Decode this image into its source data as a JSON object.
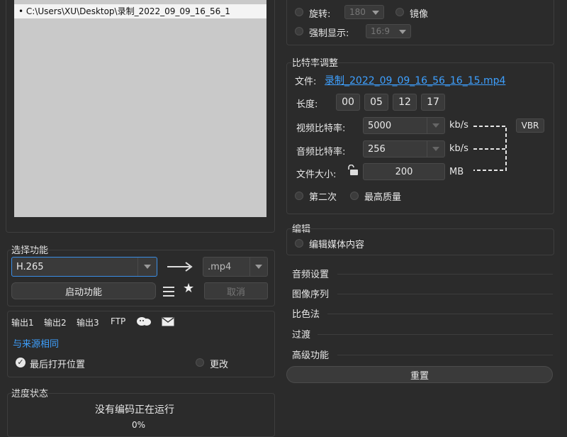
{
  "file_list": {
    "items": [
      "C:\\Users\\XU\\Desktop\\录制_2022_09_09_16_56_1"
    ]
  },
  "transform": {
    "rotate_label": "旋转:",
    "rotate_value": "180",
    "mirror_label": "镜像",
    "force_display_label": "强制显示:",
    "force_display_value": "16:9"
  },
  "bitrate": {
    "section_title": "比特率调整",
    "file_label": "文件:",
    "file_value": "录制_2022_09_09_16_56_16_15.mp4",
    "duration_label": "长度:",
    "duration": [
      "00",
      "05",
      "12",
      "17"
    ],
    "video_label": "视频比特率:",
    "video_value": "5000",
    "video_unit": "kb/s",
    "audio_label": "音频比特率:",
    "audio_value": "256",
    "audio_unit": "kb/s",
    "size_label": "文件大小:",
    "size_value": "200",
    "size_unit": "MB",
    "vbr_label": "VBR",
    "second_pass_label": "第二次",
    "best_quality_label": "最高质量"
  },
  "edit": {
    "title": "编辑",
    "media_label": "编辑媒体内容"
  },
  "collapsibles": [
    "音频设置",
    "图像序列",
    "比色法",
    "过渡",
    "高级功能"
  ],
  "reset_label": "重置",
  "function": {
    "title": "选择功能",
    "codec": "H.265",
    "container": ".mp4",
    "start_label": "启动功能",
    "cancel_label": "取消"
  },
  "output": {
    "tabs": [
      "输出1",
      "输出2",
      "输出3",
      "FTP"
    ],
    "same_as_source": "与来源相同",
    "last_open_label": "最后打开位置",
    "change_label": "更改"
  },
  "progress": {
    "title": "进度状态",
    "status": "没有编码正在运行",
    "percent": "0%"
  }
}
